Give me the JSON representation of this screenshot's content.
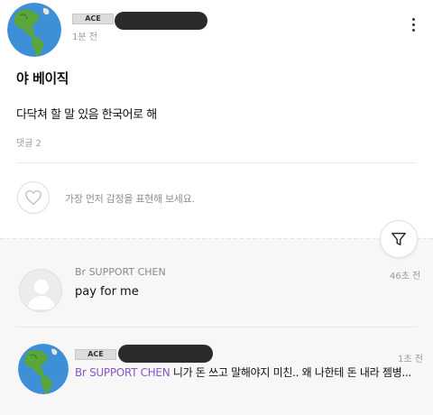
{
  "post": {
    "author_badge": "ACE",
    "time": "1분 전",
    "title": "야 베이직",
    "body": "다닥쳐 할 말 있음 한국어로 해",
    "comment_count": "댓글 2",
    "like_prompt": "가장 먼저 감정을 표현해 보세요."
  },
  "comments": [
    {
      "author_name": "Br SUPPORT CHEN",
      "text": "pay for me",
      "time": "46초 전"
    },
    {
      "author_badge": "ACE",
      "time": "1초 전",
      "mention": "Br SUPPORT CHEN",
      "text": " 니가 돈 쓰고 말해야지 미친.. 왜 나한테 돈 내라 젬병..."
    }
  ],
  "icons": {
    "avatar": "globe-icon",
    "menu": "kebab-icon",
    "like": "heart-icon",
    "filter": "filter-icon",
    "default_avatar": "person-placeholder-icon"
  },
  "colors": {
    "mention": "#8a55c8",
    "redacted": "#2b2b2b",
    "comments_bg": "#f7f7f7"
  }
}
